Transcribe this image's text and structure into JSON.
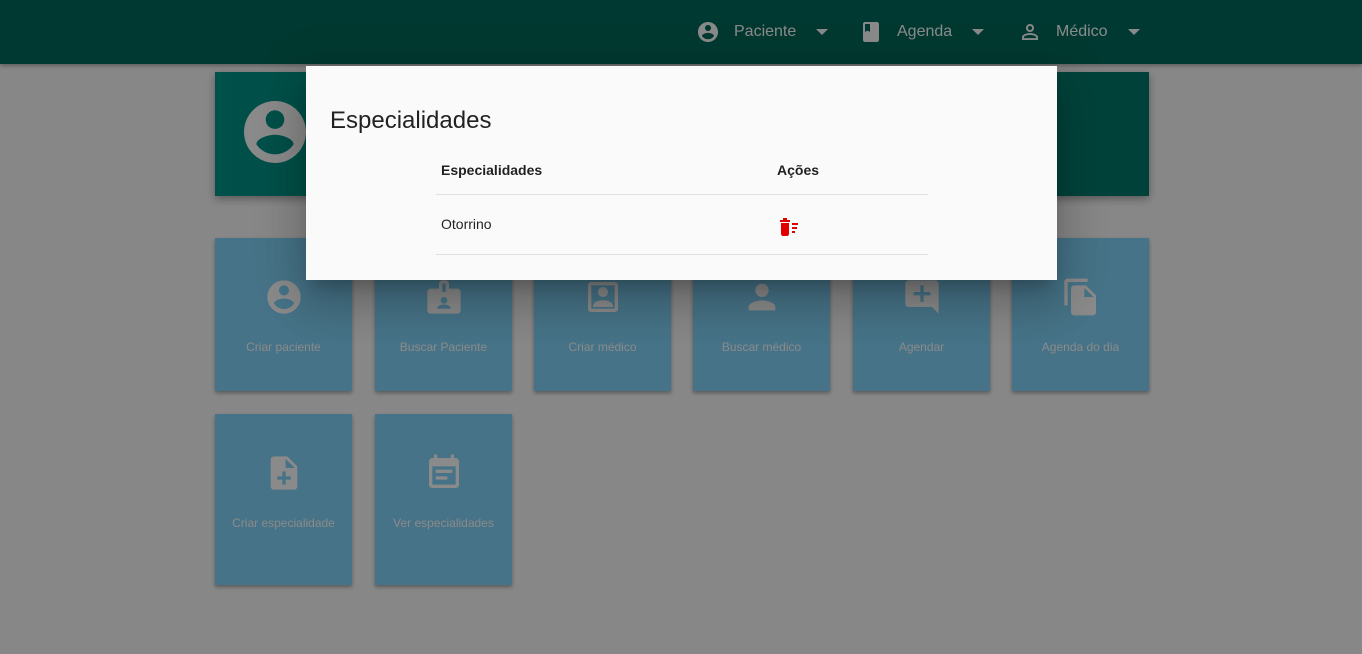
{
  "nav": {
    "items": [
      {
        "label": "Paciente",
        "icon": "account-circle-icon"
      },
      {
        "label": "Agenda",
        "icon": "book-icon"
      },
      {
        "label": "Médico",
        "icon": "person-outline-icon"
      }
    ]
  },
  "hero": {
    "icon": "account-circle-icon"
  },
  "tiles": [
    {
      "label": "Criar paciente",
      "icon": "account-circle-icon"
    },
    {
      "label": "Buscar Paciente",
      "icon": "contact-badge-icon"
    },
    {
      "label": "Criar médico",
      "icon": "contact-portrait-icon"
    },
    {
      "label": "Buscar médico",
      "icon": "person-icon"
    },
    {
      "label": "Agendar",
      "icon": "add-comment-icon"
    },
    {
      "label": "Agenda do dia",
      "icon": "file-copy-icon"
    },
    {
      "label": "Criar especialidade",
      "icon": "note-add-icon"
    },
    {
      "label": "Ver especialidades",
      "icon": "event-note-icon"
    }
  ],
  "dialog": {
    "title": "Especialidades",
    "table": {
      "headers": [
        "Especialidades",
        "Ações"
      ],
      "rows": [
        {
          "especialidade": "Otorrino",
          "action_icon": "delete-sweep-icon"
        }
      ]
    }
  },
  "colors": {
    "topbar": "#00695c",
    "hero": "#009688",
    "tile": "#81d4fa",
    "delete": "#e00000"
  }
}
